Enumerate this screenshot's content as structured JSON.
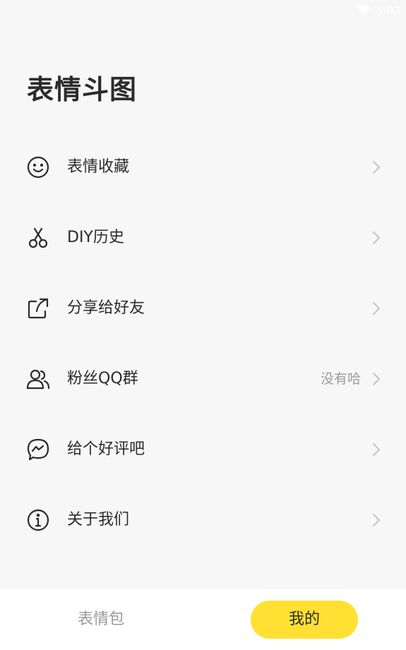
{
  "status_bar": {
    "time": "5:03"
  },
  "page_title": "表情斗图",
  "menu": [
    {
      "label": "表情收藏",
      "icon": "smile-icon",
      "extra": ""
    },
    {
      "label": "DIY历史",
      "icon": "scissors-icon",
      "extra": ""
    },
    {
      "label": "分享给好友",
      "icon": "share-icon",
      "extra": ""
    },
    {
      "label": "粉丝QQ群",
      "icon": "users-icon",
      "extra": "没有哈"
    },
    {
      "label": "给个好评吧",
      "icon": "messenger-icon",
      "extra": ""
    },
    {
      "label": "关于我们",
      "icon": "info-icon",
      "extra": ""
    }
  ],
  "tabs": [
    {
      "label": "表情包",
      "active": false
    },
    {
      "label": "我的",
      "active": true
    }
  ],
  "colors": {
    "background": "#f7f7f7",
    "accent": "#ffe033",
    "text": "#2b2b2b",
    "muted": "#9a9a9a"
  }
}
